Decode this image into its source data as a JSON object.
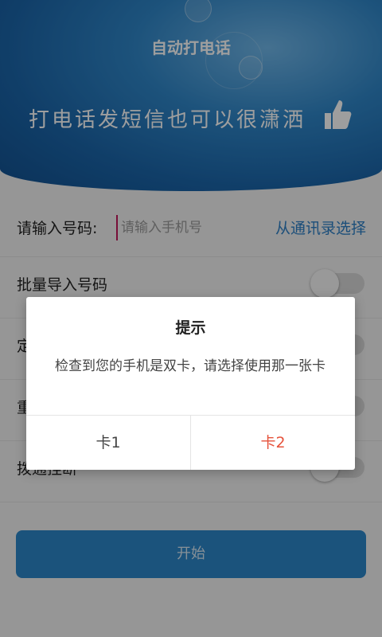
{
  "header": {
    "title": "自动打电话",
    "slogan": "打电话发短信也可以很潇洒"
  },
  "phone_row": {
    "label": "请输入号码:",
    "placeholder": "请输入手机号",
    "contacts_link": "从通讯录选择"
  },
  "options": [
    {
      "label": "批量导入号码",
      "enabled": false
    },
    {
      "label": "定",
      "enabled": false
    },
    {
      "label": "重",
      "enabled": false
    },
    {
      "label": "拨通挂断",
      "enabled": false
    }
  ],
  "start_button": "开始",
  "dialog": {
    "title": "提示",
    "message": "检查到您的手机是双卡，请选择使用那一张卡",
    "buttons": [
      "卡1",
      "卡2"
    ]
  },
  "colors": {
    "accent": "#2d7fc5",
    "card2": "#e6533c"
  }
}
